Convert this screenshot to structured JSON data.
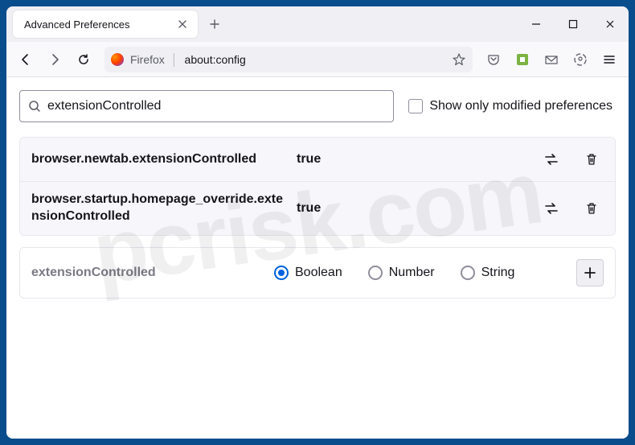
{
  "tab": {
    "title": "Advanced Preferences"
  },
  "urlbar": {
    "identity": "Firefox",
    "url": "about:config"
  },
  "search": {
    "value": "extensionControlled"
  },
  "modified_label": "Show only modified preferences",
  "prefs": [
    {
      "name": "browser.newtab.extensionControlled",
      "value": "true"
    },
    {
      "name": "browser.startup.homepage_override.extensionControlled",
      "value": "true"
    }
  ],
  "add": {
    "name": "extensionControlled",
    "types": [
      "Boolean",
      "Number",
      "String"
    ],
    "selected": "Boolean"
  },
  "watermark": "pcrisk.com"
}
